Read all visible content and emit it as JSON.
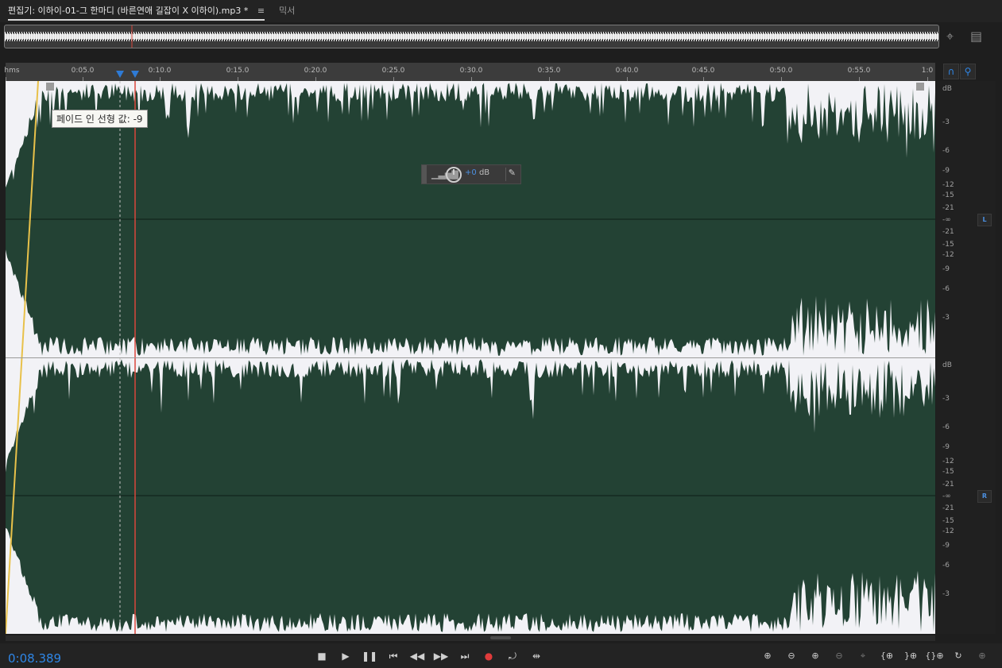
{
  "tabs": {
    "editor_label": "편집기: 이하이-01-그 한마디 (바른연애 길잡이 X 이하이).mp3 *",
    "menu_glyph": "≡",
    "mixer_label": "믹서"
  },
  "overview": {
    "icons": [
      "zoom-crosshair-icon",
      "panel-layout-icon"
    ]
  },
  "ruler": {
    "labels": [
      "hms",
      "0:05.0",
      "0:10.0",
      "0:15.0",
      "0:20.0",
      "0:25.0",
      "0:30.0",
      "0:35.0",
      "0:40.0",
      "0:45.0",
      "0:50.0",
      "0:55.0",
      "1:0"
    ]
  },
  "right_buttons": {
    "headphone_icon": "headphones-icon",
    "marker_icon": "pin-marker-icon"
  },
  "tooltip": {
    "text": "페이드 인 선형 값: -9"
  },
  "hud": {
    "value": "+0",
    "unit": "dB"
  },
  "db_scale": {
    "unit": "dB",
    "top_channel": [
      "-3",
      "-6",
      "-9",
      "-12",
      "-15",
      "-21",
      "-∞",
      "-21",
      "-15",
      "-12",
      "-9",
      "-6",
      "-3"
    ],
    "bottom_channel": [
      "-3",
      "-6",
      "-9",
      "-12",
      "-15",
      "-21",
      "-∞",
      "-21",
      "-15",
      "-12",
      "-9",
      "-6",
      "-3"
    ],
    "left_badge": "L",
    "right_badge": "R"
  },
  "transport": {
    "time": "0:08.389",
    "buttons": [
      "stop",
      "play",
      "pause",
      "go-to-start",
      "rewind",
      "fast-forward",
      "go-to-end",
      "record",
      "loop",
      "skip-selection"
    ]
  },
  "zoom_buttons": [
    "zoom-in-amplitude",
    "zoom-out-amplitude",
    "zoom-in-time",
    "zoom-out-time",
    "zoom-out-full",
    "zoom-in-left",
    "zoom-in-right",
    "zoom-selection",
    "zoom-reset",
    "zoom-tracks"
  ],
  "colors": {
    "waveform": "#234234",
    "waveform_bg": "#f2f2f6",
    "playhead": "#d9463b",
    "fade_line": "#e8c14a",
    "accent": "#2f86e6",
    "record": "#e03b3b"
  }
}
